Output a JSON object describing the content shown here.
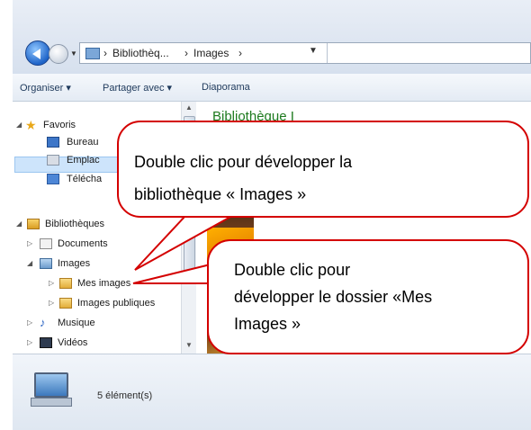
{
  "window": {
    "address": {
      "seg1": "Bibliothèq...",
      "seg2": "Images"
    },
    "toolbar": {
      "organiser": "Organiser ▾",
      "partager": "Partager avec ▾",
      "diaporama": "Diaporama"
    },
    "tree": {
      "favoris": "Favoris",
      "bureau": "Bureau",
      "emplacements": "Emplac",
      "telechargements": "Télécha",
      "bibliotheques": "Bibliothèques",
      "documents": "Documents",
      "images": "Images",
      "mes_images": "Mes images",
      "images_publiques": "Images publiques",
      "musique": "Musique",
      "videos": "Vidéos"
    },
    "content_title": "Bibliothèque I",
    "status": "5 élément(s)"
  },
  "callouts": {
    "first": {
      "line1": "Double clic pour développer la",
      "line2": "bibliothèque « Images »"
    },
    "second": {
      "line1": "Double clic pour",
      "line2": "développer le dossier «Mes",
      "line3": "Images »"
    }
  },
  "colors": {
    "callout_border": "#d40000",
    "library_title": "#1e7a1e",
    "selection": "#cde4fb"
  },
  "icons": [
    "back-icon",
    "forward-icon",
    "folder-icon",
    "star-icon",
    "desktop-icon",
    "recent-places-icon",
    "downloads-icon",
    "library-icon",
    "document-icon",
    "pictures-icon",
    "music-icon",
    "video-icon",
    "computer-icon"
  ]
}
